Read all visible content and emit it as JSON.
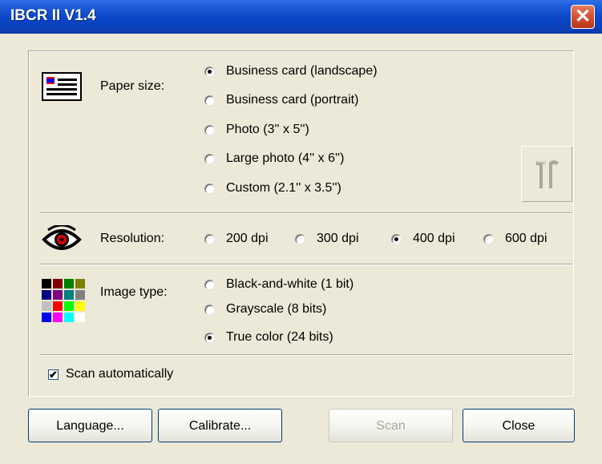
{
  "window": {
    "title": "IBCR II V1.4",
    "close_glyph": "✕"
  },
  "paper_size": {
    "label": "Paper size:",
    "icon": "business-card-icon",
    "options": [
      {
        "label": "Business card (landscape)",
        "checked": true
      },
      {
        "label": "Business card (portrait)",
        "checked": false
      },
      {
        "label": "Photo (3'' x 5'')",
        "checked": false
      },
      {
        "label": "Large photo (4'' x 6'')",
        "checked": false
      },
      {
        "label": "Custom (2.1'' x 3.5'')",
        "checked": false
      }
    ],
    "tool_button_icon": "tools-icon"
  },
  "resolution": {
    "label": "Resolution:",
    "icon": "eye-icon",
    "options": [
      {
        "label": "200 dpi",
        "checked": false
      },
      {
        "label": "300 dpi",
        "checked": false
      },
      {
        "label": "400 dpi",
        "checked": true
      },
      {
        "label": "600 dpi",
        "checked": false
      }
    ]
  },
  "image_type": {
    "label": "Image type:",
    "icon": "color-palette-icon",
    "options": [
      {
        "label": "Black-and-white (1 bit)",
        "checked": false
      },
      {
        "label": "Grayscale (8 bits)",
        "checked": false
      },
      {
        "label": "True color (24 bits)",
        "checked": true
      }
    ],
    "palette_colors": [
      "#000000",
      "#800000",
      "#008000",
      "#808000",
      "#000080",
      "#800080",
      "#008080",
      "#808080",
      "#c0c0c0",
      "#ff0000",
      "#00ff00",
      "#ffff00",
      "#0000ff",
      "#ff00ff",
      "#00ffff",
      "#ffffff"
    ]
  },
  "scan_automatically": {
    "label": "Scan automatically",
    "checked": true,
    "mark": "✔"
  },
  "buttons": {
    "language": "Language...",
    "calibrate": "Calibrate...",
    "scan": "Scan",
    "close": "Close"
  },
  "colors": {
    "titlebar": "#0a46c8",
    "dialog_bg": "#ece9d8",
    "close_button": "#cf4a2a"
  }
}
